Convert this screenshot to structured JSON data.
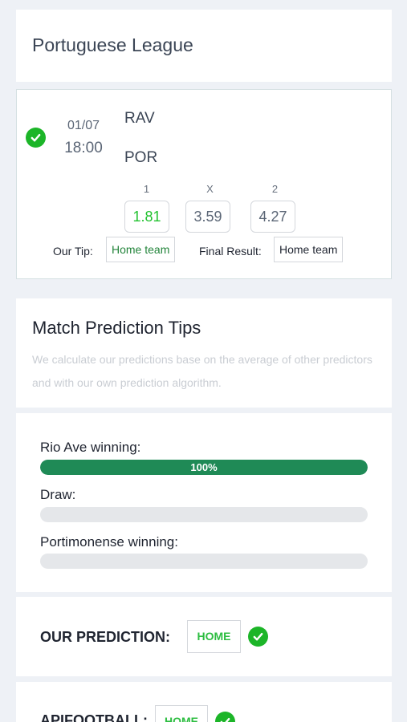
{
  "league": {
    "title": "Portuguese League"
  },
  "match": {
    "date": "01/07",
    "time": "18:00",
    "home_team": "RAV",
    "away_team": "POR",
    "odds": [
      {
        "label": "1",
        "value": "1.81"
      },
      {
        "label": "X",
        "value": "3.59"
      },
      {
        "label": "2",
        "value": "4.27"
      }
    ],
    "tip_label": "Our Tip:",
    "tip_value": "Home team",
    "result_label": "Final Result:",
    "result_value": "Home team",
    "status_icon": "check-circle-icon"
  },
  "tips": {
    "title": "Match Prediction Tips",
    "description": "We calculate our predictions base on the average of other predictors and with our own prediction algorithm."
  },
  "probabilities": [
    {
      "label": "Rio Ave winning:",
      "percent": 100,
      "text": "100%"
    },
    {
      "label": "Draw:",
      "percent": 0,
      "text": ""
    },
    {
      "label": "Portimonense winning:",
      "percent": 0,
      "text": ""
    }
  ],
  "prediction": {
    "label": "OUR PREDICTION:",
    "value": "HOME",
    "status_icon": "check-circle-icon"
  },
  "api_prediction": {
    "label": "APIFOOTBALL:",
    "value": "HOME",
    "status_icon": "check-circle-icon"
  },
  "colors": {
    "success": "#1cb528",
    "bar_fill": "#1f8a56",
    "bar_track": "#e5e7ea",
    "page_bg": "#eef1f6"
  }
}
